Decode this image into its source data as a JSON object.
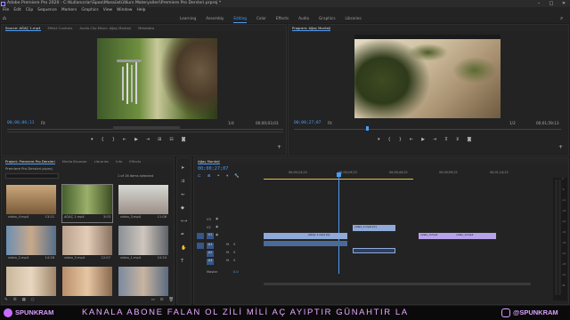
{
  "window": {
    "title": "Adobe Premiere Pro 2020 - C:\\Kullanıcılar\\Spoo\\Masaüstü\\Kurs Materyalleri\\Premiere Pro Dersleri.prproj *",
    "controls": [
      "–",
      "□",
      "✕"
    ]
  },
  "menu": [
    "File",
    "Edit",
    "Clip",
    "Sequence",
    "Markers",
    "Graphics",
    "View",
    "Window",
    "Help"
  ],
  "workspaces": {
    "tabs": [
      "Learning",
      "Assembly",
      "Editing",
      "Color",
      "Effects",
      "Audio",
      "Graphics",
      "Libraries"
    ],
    "active": "Editing"
  },
  "source": {
    "tabs": [
      "Source: AĞAÇ 1.mp4",
      "Effect Controls",
      "Audio Clip Mixer: Ağaç Monteji",
      "Metadata"
    ],
    "timecode": "00;00;06;11",
    "fit": "Fit",
    "ratio": "1/4",
    "duration": "00;00;03;03"
  },
  "program": {
    "tabs": [
      "Program: Ağaç Monteji"
    ],
    "timecode": "00;00;27;07",
    "fit": "Fit",
    "ratio": "1/2",
    "duration": "00;01;59;13"
  },
  "project": {
    "tabs": [
      "Project: Premiere Pro Dersleri",
      "Media Browser",
      "Libraries",
      "Info",
      "Effects"
    ],
    "path": "Premiere Pro Dersleri.prproj",
    "selection": "1 of 16 items selected",
    "items": [
      {
        "name": "video_4.mp4",
        "duration": "13:21"
      },
      {
        "name": "AĞAÇ 1.mp4",
        "duration": "3:03"
      },
      {
        "name": "video_3.mp4",
        "duration": "11:06"
      },
      {
        "name": "video_2.mp4",
        "duration": "14:26"
      },
      {
        "name": "video_5.mp4",
        "duration": "12:07"
      },
      {
        "name": "video_1.mp4",
        "duration": "10:24"
      },
      {
        "name": "",
        "duration": ""
      },
      {
        "name": "",
        "duration": ""
      },
      {
        "name": "",
        "duration": ""
      }
    ]
  },
  "timeline": {
    "tab": "Ağaç Monteji",
    "timecode": "00;00;27;07",
    "ruler": [
      "00;00;14;23",
      "00;00;29;23",
      "00;00;44;22",
      "00;00;59;22",
      "00;01;14;22"
    ],
    "tracks": {
      "video": [
        "V3",
        "V2",
        "V1"
      ],
      "audio": [
        "A1",
        "A2",
        "A3"
      ],
      "master": "Master",
      "master_value": "0.0"
    },
    "clips": [
      {
        "label": "video_1.mp4 [V]"
      },
      {
        "label": "AĞAÇ 1.mp4 [V]"
      },
      {
        "label": "video_3.mp4"
      },
      {
        "label": "video_4.mp4"
      }
    ],
    "meter_labels": [
      "0",
      "-6",
      "-12",
      "-18",
      "-24",
      "-30",
      "-36",
      "-42",
      "-48",
      "-54",
      "dB"
    ]
  },
  "banner": {
    "channel_left": "SPUNKRAM",
    "marquee": "KANALA ABONE FALAN OL ZİLİ MİLİ AÇ AYIPTIR GÜNAHTIR LA",
    "channel_right": "@SPUNKRAM",
    "marquee_color": "#e8a9ff"
  },
  "colors": {
    "accent": "#4e9cf5",
    "clip_blue": "#8fa9d8",
    "clip_violet": "#b7a3ea",
    "playhead": "#4e9cf5"
  }
}
